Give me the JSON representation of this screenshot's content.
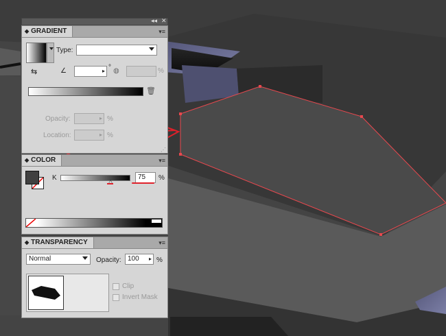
{
  "gradient": {
    "title": "GRADIENT",
    "type_label": "Type:",
    "type_value": "",
    "angle_value": "",
    "angle_unit": "°",
    "aspect_value": "",
    "aspect_unit": "%",
    "opacity_label": "Opacity:",
    "opacity_value": "",
    "opacity_unit": "%",
    "location_label": "Location:",
    "location_value": "",
    "location_unit": "%"
  },
  "color": {
    "title": "COLOR",
    "channel_label": "K",
    "k_value": "75",
    "k_unit": "%",
    "slider_fraction": 0.75
  },
  "transparency": {
    "title": "TRANSPARENCY",
    "blend_mode": "Normal",
    "opacity_label": "Opacity:",
    "opacity_value": "100",
    "opacity_unit": "%",
    "clip_label": "Clip",
    "invert_mask_label": "Invert Mask"
  },
  "colors": {
    "panel_bg": "#d6d6d6",
    "selection": "#e8484e",
    "annotation": "#e0202a"
  },
  "icons": [
    "collapse-panel-icon",
    "close-panel-icon",
    "panel-menu-icon",
    "reverse-gradient-icon",
    "angle-icon",
    "aspect-ratio-icon",
    "trash-icon",
    "none-swatch-icon",
    "slider-triangle-icon",
    "dropdown-arrow-icon",
    "stepper-icon"
  ]
}
